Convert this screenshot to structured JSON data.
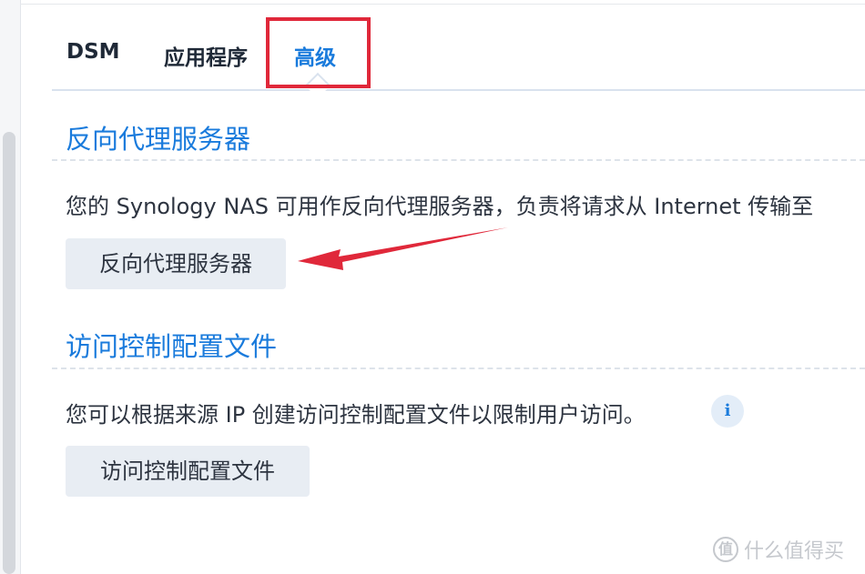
{
  "tabs": [
    {
      "label": "DSM",
      "active": false
    },
    {
      "label": "应用程序",
      "active": false
    },
    {
      "label": "高级",
      "active": true
    }
  ],
  "sections": [
    {
      "title": "反向代理服务器",
      "description": "您的 Synology NAS 可用作反向代理服务器，负责将请求从 Internet 传输至",
      "button_label": "反向代理服务器"
    },
    {
      "title": "访问控制配置文件",
      "description": "您可以根据来源 IP 创建访问控制配置文件以限制用户访问。",
      "button_label": "访问控制配置文件",
      "info_icon": "i"
    }
  ],
  "watermark": {
    "logo_glyph": "值",
    "text": "什么值得买"
  },
  "colors": {
    "accent": "#1a7bdc",
    "annotation_red": "#e0283a"
  },
  "icons": [
    "info-icon",
    "annotation-arrow",
    "watermark-logo-icon"
  ]
}
